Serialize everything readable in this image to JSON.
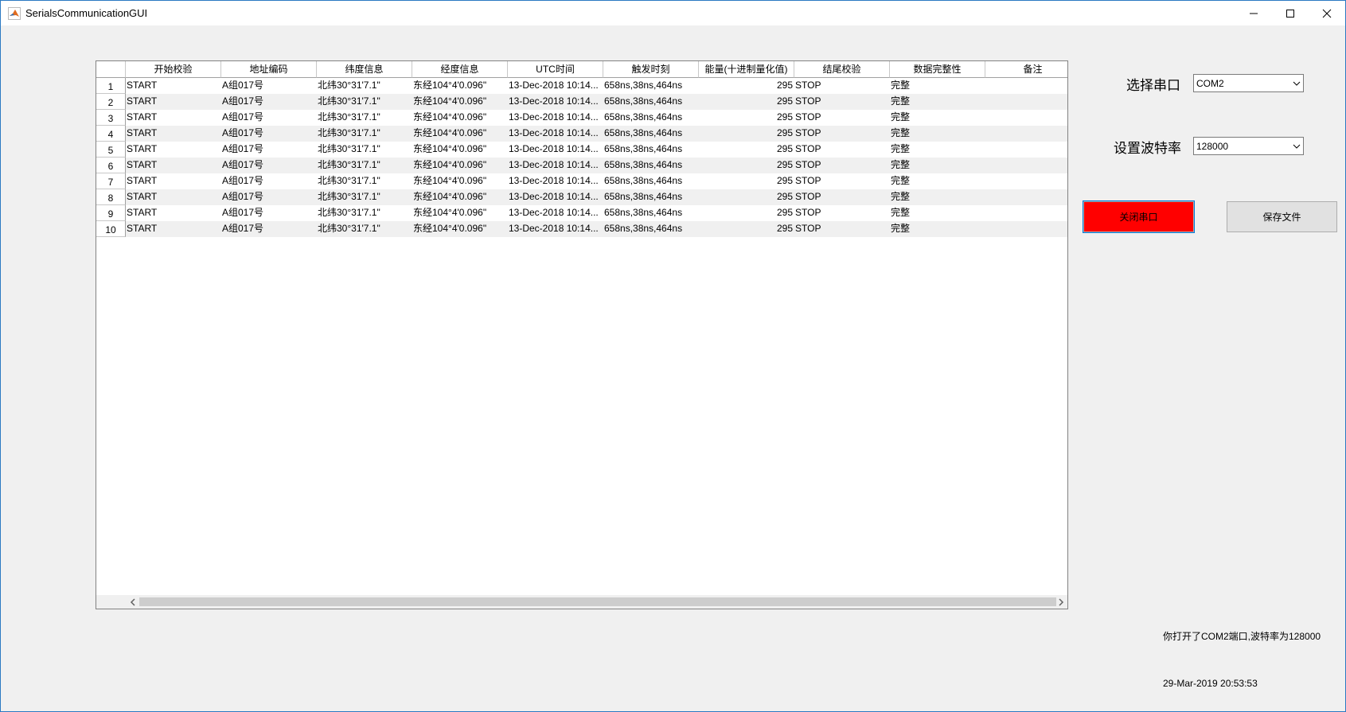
{
  "window": {
    "title": "SerialsCommunicationGUI"
  },
  "table": {
    "columns": [
      "开始校验",
      "地址编码",
      "纬度信息",
      "经度信息",
      "UTC时间",
      "触发时刻",
      "能量(十进制量化值)",
      "结尾校验",
      "数据完整性",
      "备注"
    ],
    "rows": [
      {
        "num": "1",
        "cells": [
          "START",
          "A组017号",
          "北纬30°31'7.1\"",
          "东经104°4'0.096\"",
          "13-Dec-2018 10:14...",
          "658ns,38ns,464ns",
          "295",
          "STOP",
          "完整",
          ""
        ]
      },
      {
        "num": "2",
        "cells": [
          "START",
          "A组017号",
          "北纬30°31'7.1\"",
          "东经104°4'0.096\"",
          "13-Dec-2018 10:14...",
          "658ns,38ns,464ns",
          "295",
          "STOP",
          "完整",
          ""
        ]
      },
      {
        "num": "3",
        "cells": [
          "START",
          "A组017号",
          "北纬30°31'7.1\"",
          "东经104°4'0.096\"",
          "13-Dec-2018 10:14...",
          "658ns,38ns,464ns",
          "295",
          "STOP",
          "完整",
          ""
        ]
      },
      {
        "num": "4",
        "cells": [
          "START",
          "A组017号",
          "北纬30°31'7.1\"",
          "东经104°4'0.096\"",
          "13-Dec-2018 10:14...",
          "658ns,38ns,464ns",
          "295",
          "STOP",
          "完整",
          ""
        ]
      },
      {
        "num": "5",
        "cells": [
          "START",
          "A组017号",
          "北纬30°31'7.1\"",
          "东经104°4'0.096\"",
          "13-Dec-2018 10:14...",
          "658ns,38ns,464ns",
          "295",
          "STOP",
          "完整",
          ""
        ]
      },
      {
        "num": "6",
        "cells": [
          "START",
          "A组017号",
          "北纬30°31'7.1\"",
          "东经104°4'0.096\"",
          "13-Dec-2018 10:14...",
          "658ns,38ns,464ns",
          "295",
          "STOP",
          "完整",
          ""
        ]
      },
      {
        "num": "7",
        "cells": [
          "START",
          "A组017号",
          "北纬30°31'7.1\"",
          "东经104°4'0.096\"",
          "13-Dec-2018 10:14...",
          "658ns,38ns,464ns",
          "295",
          "STOP",
          "完整",
          ""
        ]
      },
      {
        "num": "8",
        "cells": [
          "START",
          "A组017号",
          "北纬30°31'7.1\"",
          "东经104°4'0.096\"",
          "13-Dec-2018 10:14...",
          "658ns,38ns,464ns",
          "295",
          "STOP",
          "完整",
          ""
        ]
      },
      {
        "num": "9",
        "cells": [
          "START",
          "A组017号",
          "北纬30°31'7.1\"",
          "东经104°4'0.096\"",
          "13-Dec-2018 10:14...",
          "658ns,38ns,464ns",
          "295",
          "STOP",
          "完整",
          ""
        ]
      },
      {
        "num": "10",
        "cells": [
          "START",
          "A组017号",
          "北纬30°31'7.1\"",
          "东经104°4'0.096\"",
          "13-Dec-2018 10:14...",
          "658ns,38ns,464ns",
          "295",
          "STOP",
          "完整",
          ""
        ]
      }
    ]
  },
  "controls": {
    "port_label": "选择串口",
    "port_value": "COM2",
    "baud_label": "设置波特率",
    "baud_value": "128000",
    "close_port_label": "关闭串口",
    "save_file_label": "保存文件",
    "close_port_color": "#ff0000"
  },
  "status": {
    "message": "你打开了COM2端口,波特率为128000",
    "datetime": "29-Mar-2019 20:53:53"
  }
}
